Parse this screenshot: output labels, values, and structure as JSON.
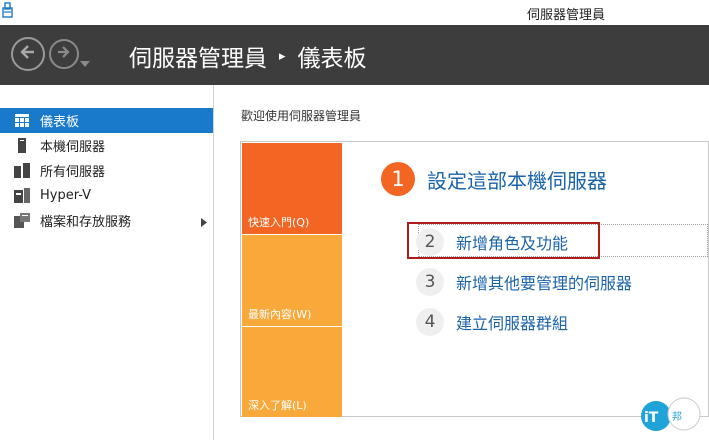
{
  "window": {
    "title": "伺服器管理員"
  },
  "header": {
    "breadcrumb": {
      "app": "伺服器管理員",
      "separator": "▸",
      "page": "儀表板"
    }
  },
  "sidebar": {
    "items": [
      {
        "label": "儀表板",
        "icon": "dashboard-icon",
        "active": true
      },
      {
        "label": "本機伺服器",
        "icon": "server-icon"
      },
      {
        "label": "所有伺服器",
        "icon": "servers-icon"
      },
      {
        "label": "Hyper-V",
        "icon": "hyperv-icon"
      },
      {
        "label": "檔案和存放服務",
        "icon": "file-storage-icon",
        "expandable": true
      }
    ]
  },
  "main": {
    "welcome": "歡迎使用伺服器管理員",
    "tiles": [
      {
        "label": "快速入門(Q)"
      },
      {
        "label": "最新內容(W)"
      },
      {
        "label": "深入了解(L)"
      }
    ],
    "steps": [
      {
        "num": "1",
        "label": "設定這部本機伺服器"
      },
      {
        "num": "2",
        "label": "新增角色及功能"
      },
      {
        "num": "3",
        "label": "新增其他要管理的伺服器"
      },
      {
        "num": "4",
        "label": "建立伺服器群組"
      }
    ]
  },
  "watermark": {
    "text": "iT邦幫忙"
  },
  "colors": {
    "header_bg": "#3d3d3d",
    "accent_blue": "#1979ca",
    "link_blue": "#1b63a8",
    "tile_orange": "#f26522",
    "tile_amber": "#f8a93a",
    "highlight_red": "#b01c1c"
  }
}
